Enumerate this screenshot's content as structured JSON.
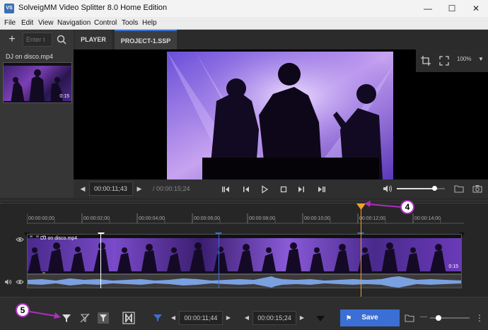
{
  "window": {
    "app_icon": "VS",
    "title": "SolveigMM Video Splitter 8.0 Home Edition"
  },
  "menu": [
    "File",
    "Edit",
    "View",
    "Navigation",
    "Control",
    "Tools",
    "Help"
  ],
  "toolbar": {
    "add_label": "+",
    "search_placeholder": "Enter t",
    "tabs": [
      "PLAYER",
      "PROJECT-1.SSP"
    ],
    "zoom_label": "100%"
  },
  "library": {
    "file_name": "DJ on disco.mp4",
    "thumb_duration": "0:15"
  },
  "player": {
    "current_time": "00:00:11;43",
    "total_time": "/ 00:00:15;24",
    "volume_level": 0.8
  },
  "timeline": {
    "ticks": [
      "00:00:00;00",
      "00:00:02;00",
      "00:00:04;00",
      "00:00:06;00",
      "00:00:08;00",
      "00:00:10;00",
      "00:00:12;00",
      "00:00:14;00"
    ],
    "clip_name": "DJ on disco.mp4",
    "clip_duration": "0:15",
    "callout_marker": "4"
  },
  "bottom": {
    "start_time": "00:00:11;44",
    "end_time": "00:00:15;24",
    "save_label": "Save",
    "callout_filter": "5"
  },
  "colors": {
    "accent": "#3b6fd4",
    "playhead": "#f0a030",
    "callout_border": "#b02dbf",
    "waveform": "#7aa0e0"
  }
}
